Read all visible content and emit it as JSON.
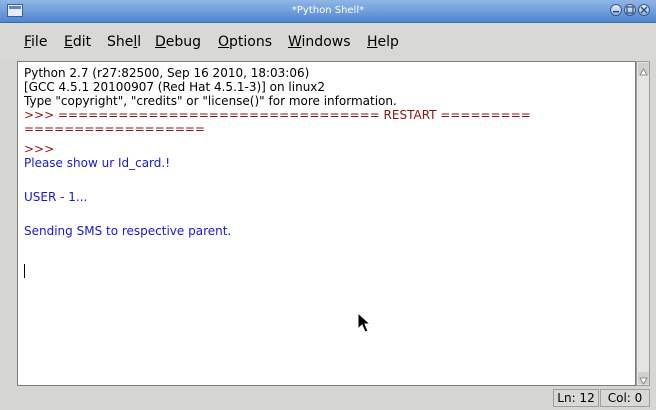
{
  "window": {
    "title": "*Python Shell*"
  },
  "menu": [
    {
      "pre": "",
      "u": "F",
      "post": "ile"
    },
    {
      "pre": "",
      "u": "E",
      "post": "dit"
    },
    {
      "pre": "She",
      "u": "l",
      "post": "l"
    },
    {
      "pre": "",
      "u": "D",
      "post": "ebug"
    },
    {
      "pre": "",
      "u": "O",
      "post": "ptions"
    },
    {
      "pre": "",
      "u": "W",
      "post": "indows"
    },
    {
      "pre": "",
      "u": "H",
      "post": "elp"
    }
  ],
  "shell": {
    "lines": [
      "Python 2.7 (r27:82500, Sep 16 2010, 18:03:06)",
      "[GCC 4.5.1 20100907 (Red Hat 4.5.1-3)] on linux2",
      "Type \"copyright\", \"credits\" or \"license()\" for more information.",
      ">>> ================================ RESTART =========",
      "==================",
      ">>> ",
      "Please show ur Id_card.!",
      "",
      "USER - 1...",
      "",
      "Sending SMS to respective parent."
    ],
    "colors": [
      "black",
      "black",
      "black",
      "red",
      "red",
      "red",
      "blue",
      "",
      "blue",
      "",
      "blue"
    ]
  },
  "status": {
    "line": "Ln: 12",
    "col": "Col: 0"
  },
  "theme": {
    "title_bar": "#4f86cf",
    "prompt": "#8b1414",
    "output": "#1818d8"
  }
}
